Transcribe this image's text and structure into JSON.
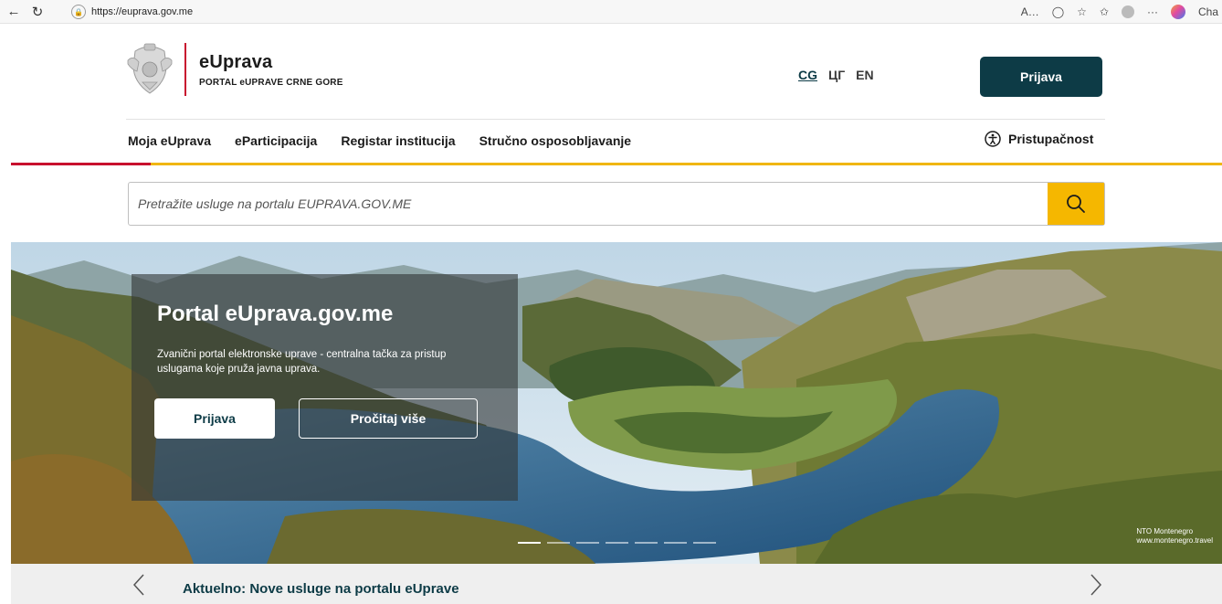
{
  "browser": {
    "url": "https://euprava.gov.me",
    "right_label": "Cha"
  },
  "header": {
    "brand_title": "eUprava",
    "brand_subtitle": "PORTAL eUPRAVE CRNE GORE",
    "languages": [
      "CG",
      "ЦГ",
      "EN"
    ],
    "login_button": "Prijava",
    "accessibility": "Pristupačnost"
  },
  "nav": {
    "items": [
      "Moja eUprava",
      "eParticipacija",
      "Registar institucija",
      "Stručno osposobljavanje"
    ]
  },
  "search": {
    "placeholder": "Pretražite usluge na portalu EUPRAVA.GOV.ME"
  },
  "hero": {
    "title": "Portal eUprava.gov.me",
    "description": "Zvanični portal elektronske uprave - centralna tačka za pristup uslugama koje pruža javna uprava.",
    "primary_button": "Prijava",
    "secondary_button": "Pročitaj više",
    "credit_line1": "NTO Montenegro",
    "credit_line2": "www.montenegro.travel",
    "slides_count": 7,
    "active_slide": 1
  },
  "news": {
    "text": "Aktuelno: Nove usluge na portalu eUprave"
  },
  "colors": {
    "primary": "#0d3b46",
    "accent_yellow": "#f5b700",
    "accent_red": "#c8102e"
  }
}
